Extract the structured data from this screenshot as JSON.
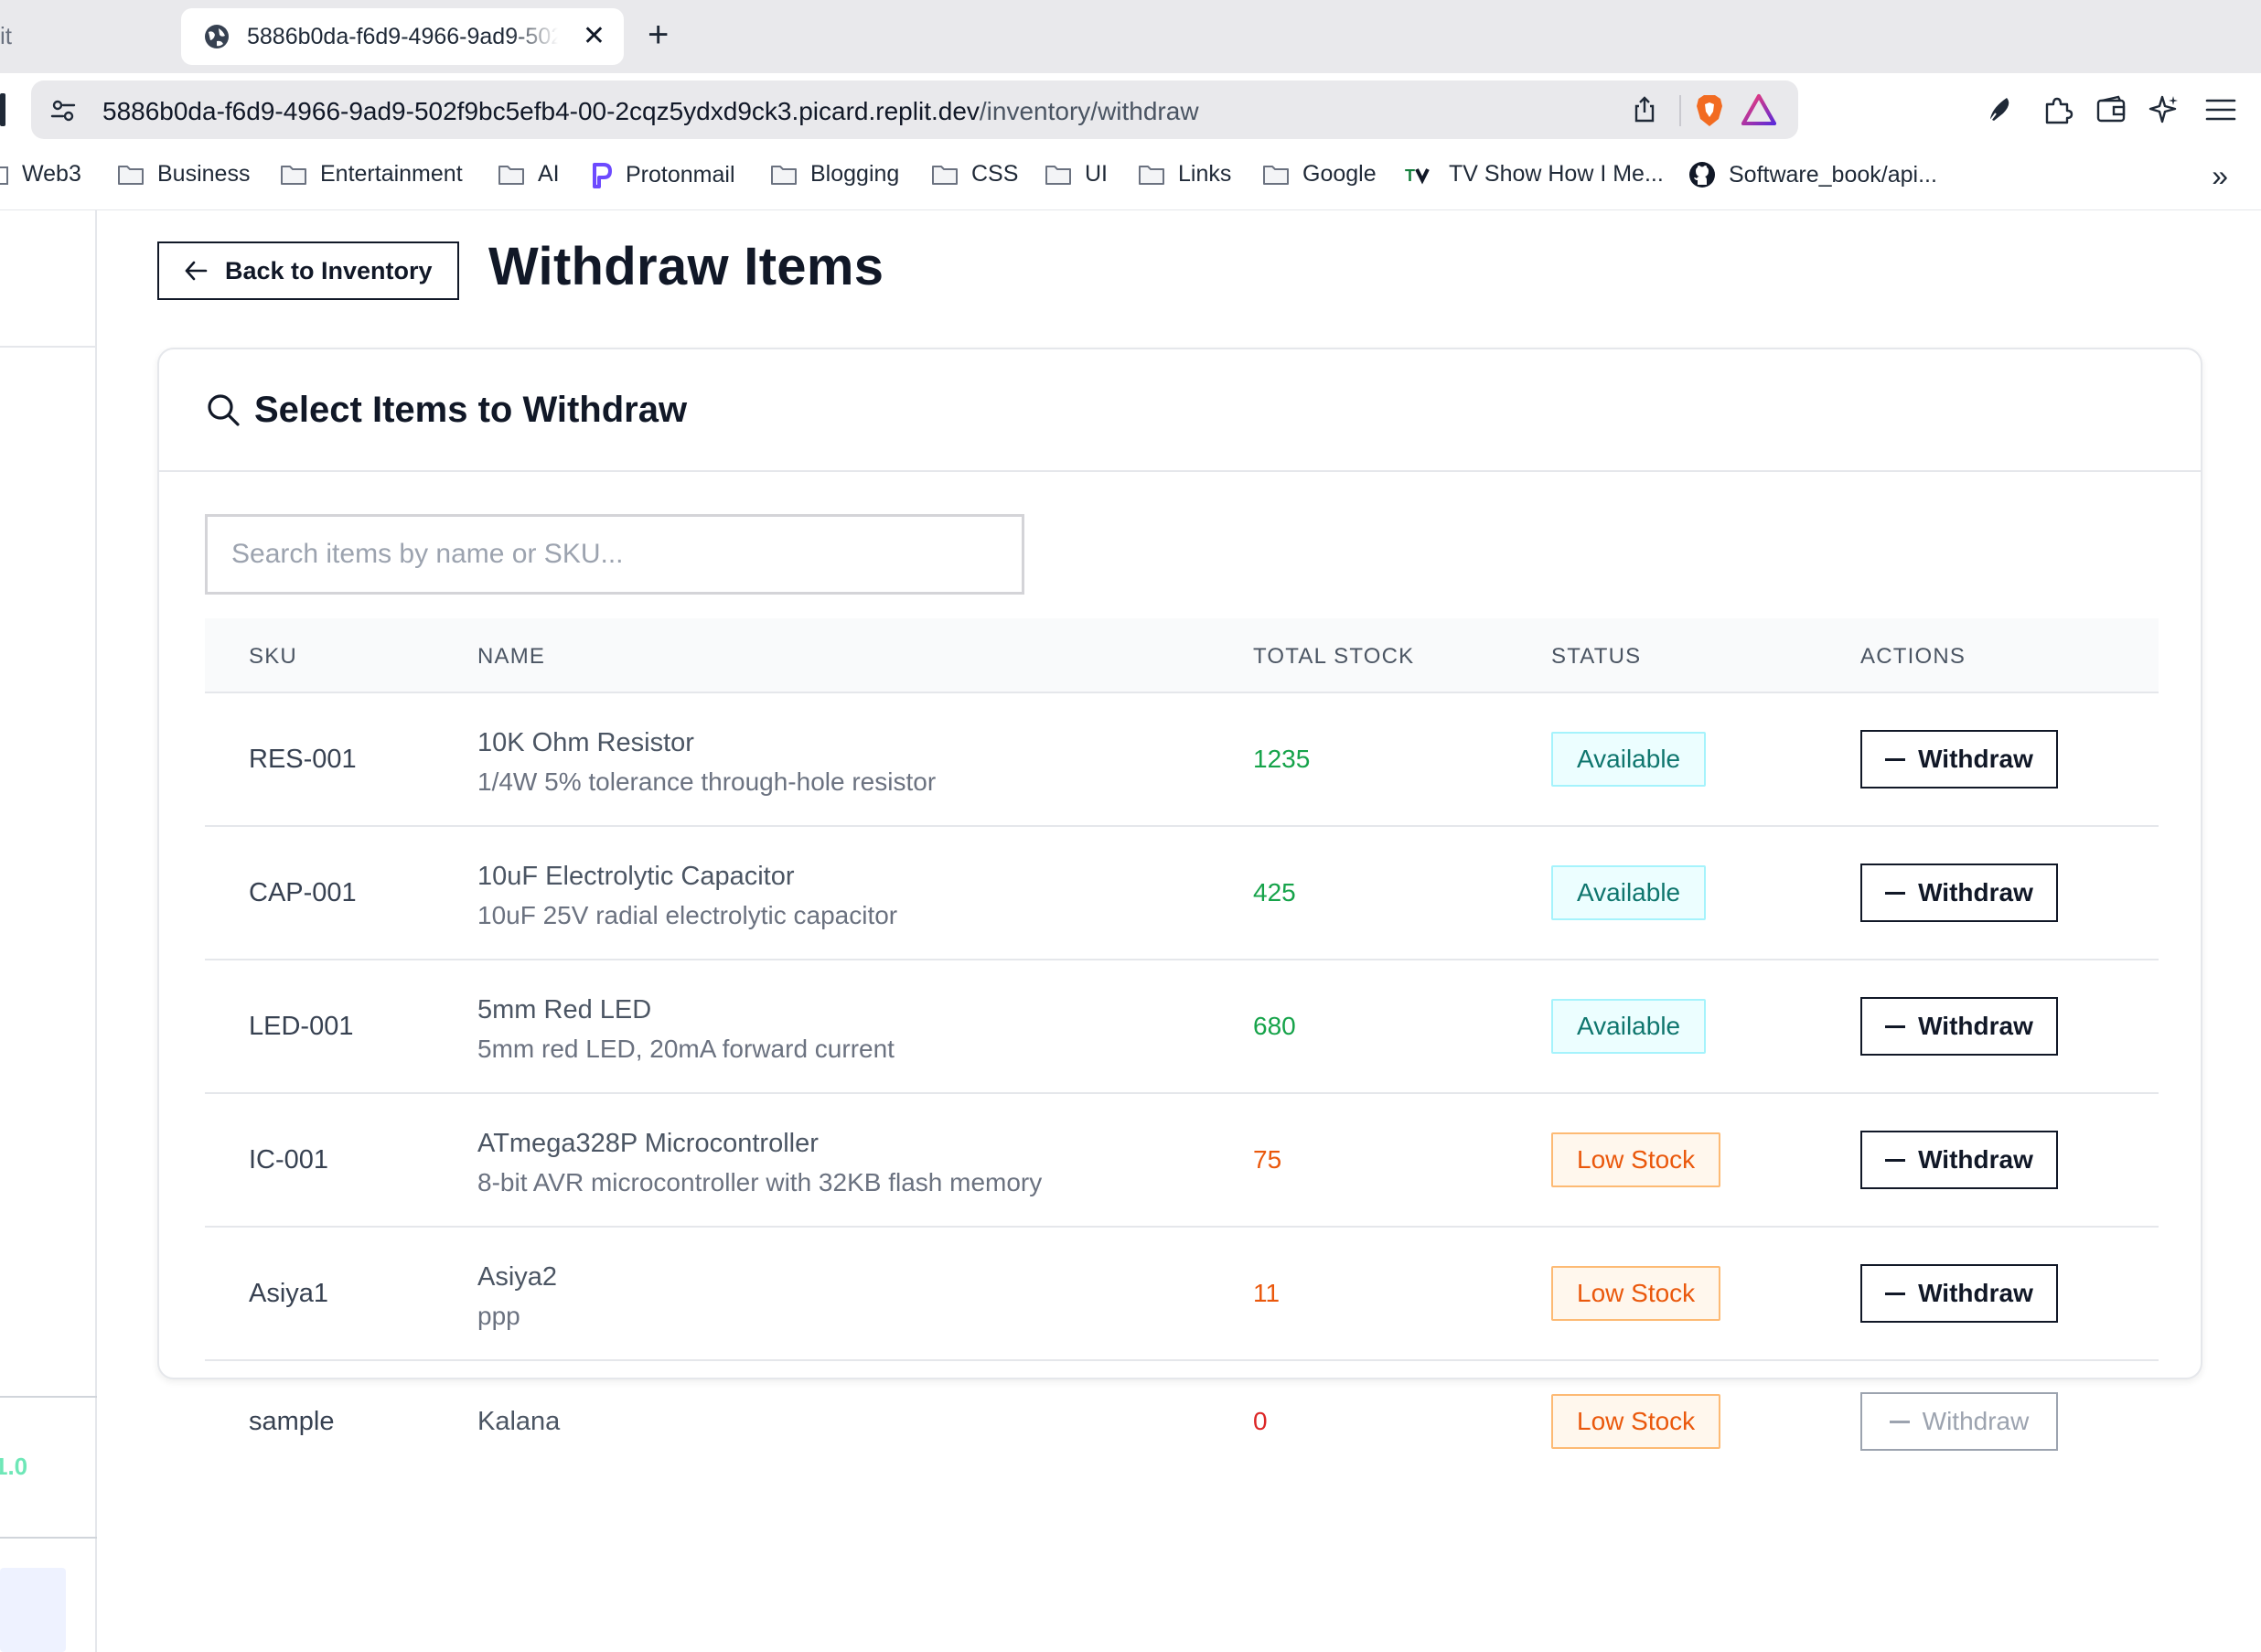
{
  "browser": {
    "prev_tab_fragment": "it",
    "active_tab_title": "5886b0da-f6d9-4966-9ad9-502f9bc5efb4",
    "url_host": "5886b0da-f6d9-4966-9ad9-502f9bc5efb4-00-2cqz5ydxd9ck3.picard.replit.dev",
    "url_path": "/inventory/withdraw",
    "bookmarks": [
      "Web3",
      "Business",
      "Entertainment",
      "AI",
      "Protonmail",
      "Blogging",
      "CSS",
      "UI",
      "Links",
      "Google",
      "TV Show How I Me...",
      "Software_book/api..."
    ]
  },
  "sidebar": {
    "version_fragment": "1.0"
  },
  "header": {
    "back_label": "Back to Inventory",
    "title": "Withdraw Items"
  },
  "card": {
    "title": "Select Items to Withdraw",
    "search_placeholder": "Search items by name or SKU...",
    "columns": [
      "SKU",
      "NAME",
      "TOTAL STOCK",
      "STATUS",
      "ACTIONS"
    ],
    "withdraw_label": "Withdraw",
    "rows": [
      {
        "sku": "RES-001",
        "name": "10K Ohm Resistor",
        "description": "1/4W 5% tolerance through-hole resistor",
        "stock": "1235",
        "status": "Available"
      },
      {
        "sku": "CAP-001",
        "name": "10uF Electrolytic Capacitor",
        "description": "10uF 25V radial electrolytic capacitor",
        "stock": "425",
        "status": "Available"
      },
      {
        "sku": "LED-001",
        "name": "5mm Red LED",
        "description": "5mm red LED, 20mA forward current",
        "stock": "680",
        "status": "Available"
      },
      {
        "sku": "IC-001",
        "name": "ATmega328P Microcontroller",
        "description": "8-bit AVR microcontroller with 32KB flash memory",
        "stock": "75",
        "status": "Low Stock"
      },
      {
        "sku": "Asiya1",
        "name": "Asiya2",
        "description": "ppp",
        "stock": "11",
        "status": "Low Stock"
      },
      {
        "sku": "sample",
        "name": "Kalana",
        "description": "",
        "stock": "0",
        "status": "Low Stock"
      }
    ]
  },
  "colors": {
    "stock_available": "#16a34a",
    "stock_low": "#ea580c",
    "stock_zero": "#dc2626",
    "badge_available_bg": "#ecfeff",
    "badge_low_bg": "#fff7ed"
  }
}
